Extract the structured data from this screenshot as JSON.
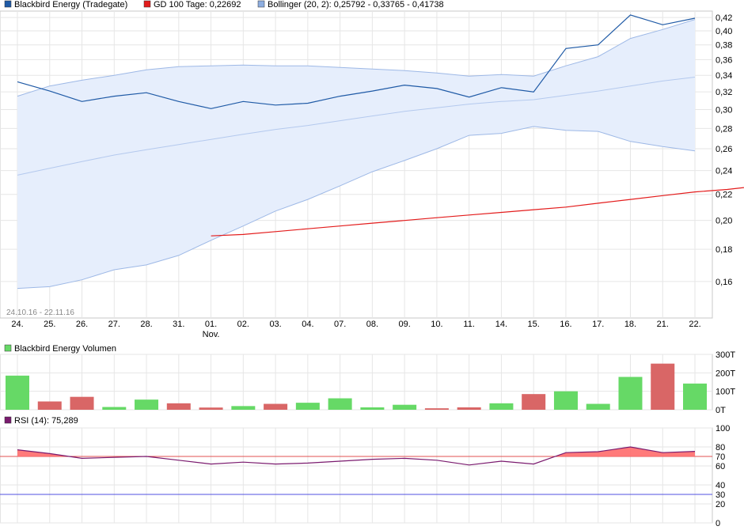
{
  "chart_data": [
    {
      "type": "line",
      "panel": "price",
      "legend": [
        {
          "label": "Blackbird Energy (Tradegate)",
          "color": "#1f5aa6"
        },
        {
          "label": "GD 100 Tage: 0,22692",
          "color": "#e31c1c"
        },
        {
          "label": "Bollinger (20, 2): 0,25792 - 0,33765 - 0,41738",
          "color": "#8eaee0"
        }
      ],
      "date_range": "24.10.16 - 22.11.16",
      "categories": [
        "24.",
        "25.",
        "26.",
        "27.",
        "28.",
        "31.",
        "01.",
        "02.",
        "03.",
        "04.",
        "07.",
        "08.",
        "09.",
        "10.",
        "11.",
        "14.",
        "15.",
        "16.",
        "17.",
        "18.",
        "21.",
        "22."
      ],
      "sub_labels": {
        "6": "Nov."
      },
      "yticks": [
        "0,42",
        "0,40",
        "0,38",
        "0,36",
        "0,34",
        "0,32",
        "0,30",
        "0,28",
        "0,26",
        "0,24",
        "0,22",
        "0,20",
        "0,18",
        "0,16"
      ],
      "ylim": [
        0.14,
        0.43
      ],
      "log_scale": true,
      "series": [
        {
          "name": "Blackbird Energy (Tradegate)",
          "values": [
            0.332,
            0.321,
            0.309,
            0.315,
            0.319,
            0.309,
            0.301,
            0.309,
            0.305,
            0.307,
            0.315,
            0.321,
            0.328,
            0.324,
            0.314,
            0.325,
            0.32,
            0.375,
            0.38,
            0.424,
            0.409,
            0.419
          ]
        },
        {
          "name": "GD 100 Tage: 0,22692",
          "start_index": 6,
          "values": [
            0.189,
            0.19,
            0.192,
            0.194,
            0.196,
            0.198,
            0.2,
            0.202,
            0.204,
            0.206,
            0.208,
            0.21,
            0.213,
            0.216,
            0.219,
            0.222,
            0.224,
            0.2269
          ]
        },
        {
          "name": "Bollinger upper",
          "values": [
            0.315,
            0.327,
            0.334,
            0.34,
            0.347,
            0.351,
            0.352,
            0.353,
            0.352,
            0.352,
            0.35,
            0.348,
            0.346,
            0.343,
            0.339,
            0.341,
            0.339,
            0.352,
            0.364,
            0.389,
            0.402,
            0.417
          ]
        },
        {
          "name": "Bollinger middle",
          "values": [
            0.236,
            0.242,
            0.248,
            0.254,
            0.259,
            0.264,
            0.269,
            0.274,
            0.279,
            0.283,
            0.288,
            0.293,
            0.298,
            0.302,
            0.306,
            0.309,
            0.311,
            0.316,
            0.321,
            0.327,
            0.333,
            0.3377
          ]
        },
        {
          "name": "Bollinger lower",
          "values": [
            0.156,
            0.157,
            0.161,
            0.167,
            0.17,
            0.176,
            0.186,
            0.196,
            0.207,
            0.216,
            0.227,
            0.239,
            0.249,
            0.26,
            0.273,
            0.275,
            0.282,
            0.278,
            0.277,
            0.267,
            0.262,
            0.2579
          ]
        }
      ]
    },
    {
      "type": "bar",
      "panel": "volume",
      "legend": {
        "label": "Blackbird Energy Volumen",
        "color": "#66d966"
      },
      "yticks": [
        "300T",
        "200T",
        "100T",
        "0T"
      ],
      "ylim": [
        0,
        300000
      ],
      "values": [
        185000,
        45000,
        70000,
        15000,
        55000,
        35000,
        12000,
        20000,
        32000,
        38000,
        62000,
        13000,
        27000,
        8000,
        13000,
        35000,
        85000,
        100000,
        32000,
        178000,
        250000,
        142000
      ],
      "colors": [
        "up",
        "down",
        "down",
        "up",
        "up",
        "down",
        "down",
        "up",
        "down",
        "up",
        "up",
        "up",
        "up",
        "down",
        "down",
        "up",
        "down",
        "up",
        "up",
        "up",
        "down",
        "up"
      ],
      "up_color": "#66d966",
      "down_color": "#d96666"
    },
    {
      "type": "line",
      "panel": "rsi",
      "legend": {
        "label": "RSI (14): 75,289",
        "color": "#7a1a6e"
      },
      "yticks": [
        "100",
        "80",
        "70",
        "60",
        "40",
        "30",
        "20",
        "0"
      ],
      "ylim": [
        0,
        100
      ],
      "overbought": 70,
      "oversold": 30,
      "overbought_color": "#e05050",
      "oversold_color": "#5050e0",
      "values": [
        77,
        73,
        68,
        69,
        70,
        66,
        62,
        64,
        62,
        63,
        65,
        67,
        68,
        66,
        61,
        65,
        62,
        74,
        75,
        80,
        74,
        75.3
      ]
    }
  ]
}
